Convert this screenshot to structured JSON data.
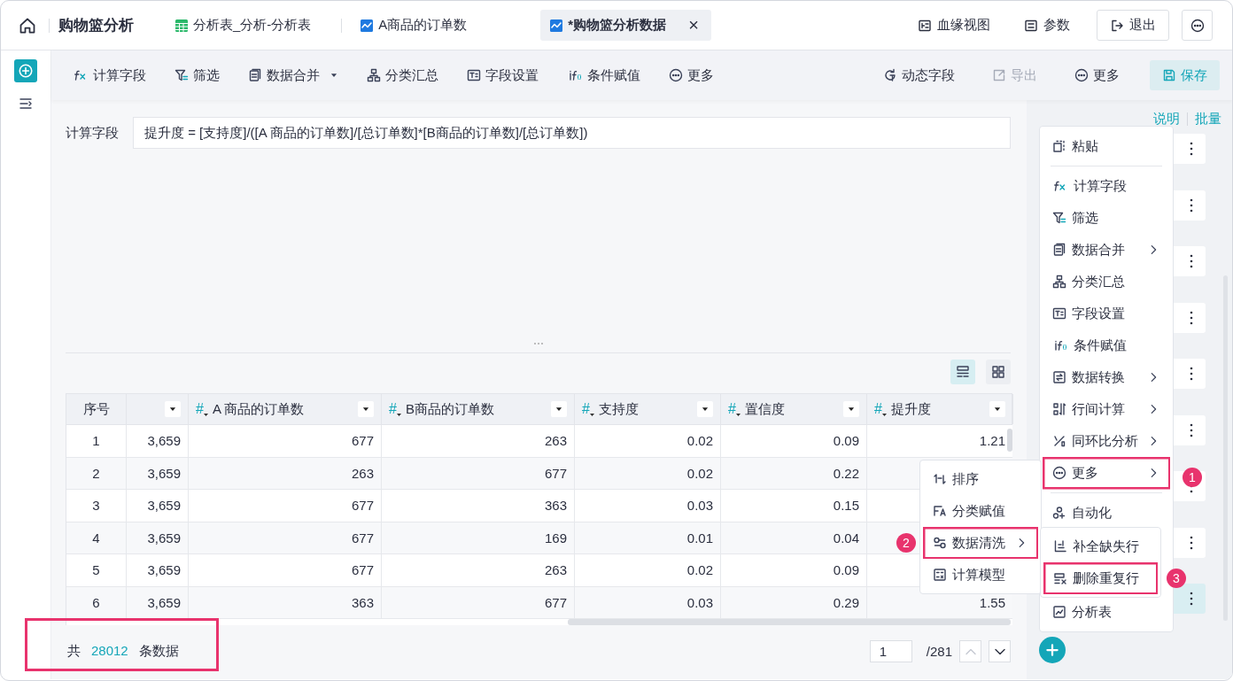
{
  "top_bar": {
    "title": "购物篮分析",
    "tabs": [
      {
        "label": "分析表_分析-分析表",
        "selected": false
      },
      {
        "label": "A商品的订单数",
        "selected": false
      },
      {
        "label": "*购物篮分析数据",
        "selected": true,
        "close": "×"
      }
    ],
    "actions": [
      {
        "kind": "link",
        "label": "血缘视图"
      },
      {
        "kind": "link",
        "label": "参数"
      },
      {
        "kind": "button",
        "label": "退出"
      },
      {
        "kind": "more"
      }
    ]
  },
  "toolbar": {
    "left": [
      {
        "label": "计算字段",
        "dropdown": false
      },
      {
        "label": "筛选",
        "dropdown": false
      },
      {
        "label": "数据合并",
        "dropdown": true
      },
      {
        "label": "分类汇总",
        "dropdown": false
      },
      {
        "label": "字段设置",
        "dropdown": false
      },
      {
        "label": "条件赋值",
        "dropdown": false
      },
      {
        "label": "更多",
        "dropdown": false
      }
    ],
    "right": [
      {
        "label": "动态字段",
        "kind": "plain",
        "disabled": false
      },
      {
        "label": "导出",
        "kind": "plain",
        "disabled": true
      },
      {
        "label": "更多",
        "kind": "plain",
        "disabled": false
      },
      {
        "label": "保存",
        "kind": "primary"
      }
    ]
  },
  "formula": {
    "label": "计算字段",
    "value": "提升度 = [支持度]/([A 商品的订单数]/[总订单数]*[B商品的订单数]/[总订单数])"
  },
  "table": {
    "view_modes": [
      {
        "selected": true
      },
      {
        "selected": false
      }
    ],
    "columns": [
      {
        "kind": "index",
        "label": "序号"
      },
      {
        "kind": "cut"
      },
      {
        "kind": "number",
        "type_symbol": "#",
        "label": "A 商品的订单数"
      },
      {
        "kind": "number",
        "type_symbol": "#",
        "label": "B商品的订单数"
      },
      {
        "kind": "number",
        "type_symbol": "#",
        "label": "支持度"
      },
      {
        "kind": "number",
        "type_symbol": "#",
        "label": "置信度"
      },
      {
        "kind": "number",
        "type_symbol": "#",
        "label": "提升度"
      }
    ],
    "rows": [
      [
        "1",
        "3,659",
        "677",
        "263",
        "0.02",
        "0.09",
        "1.21"
      ],
      [
        "2",
        "3,659",
        "263",
        "677",
        "0.02",
        "0.22",
        null
      ],
      [
        "3",
        "3,659",
        "677",
        "363",
        "0.03",
        "0.15",
        null
      ],
      [
        "4",
        "3,659",
        "677",
        "169",
        "0.01",
        "0.04",
        null
      ],
      [
        "5",
        "3,659",
        "677",
        "263",
        "0.02",
        "0.09",
        null
      ],
      [
        "6",
        "3,659",
        "363",
        "677",
        "0.03",
        "0.29",
        "1.55"
      ]
    ]
  },
  "footer": {
    "prefix": "共",
    "total": "28012",
    "suffix": "条数据",
    "highlighted": true,
    "page": "1",
    "page_count": "/281",
    "prev_disabled": true
  },
  "side_panel": {
    "links": [
      "说明",
      "批量"
    ],
    "steps": [
      {
        "selected": false
      },
      {
        "selected": false
      },
      {
        "selected": false
      },
      {
        "selected": false
      },
      {
        "selected": false
      },
      {
        "selected": false
      },
      {
        "selected": false
      },
      {
        "selected": false
      },
      {
        "selected": true
      }
    ]
  },
  "context_menu": {
    "items": [
      {
        "label": "粘贴",
        "submenu": false,
        "highlighted": false,
        "divider_after": true
      },
      {
        "label": "计算字段",
        "submenu": false,
        "highlighted": false,
        "divider_after": false
      },
      {
        "label": "筛选",
        "submenu": false,
        "highlighted": false,
        "divider_after": false
      },
      {
        "label": "数据合并",
        "submenu": true,
        "highlighted": false,
        "divider_after": false
      },
      {
        "label": "分类汇总",
        "submenu": false,
        "highlighted": false,
        "divider_after": false
      },
      {
        "label": "字段设置",
        "submenu": false,
        "highlighted": false,
        "divider_after": false
      },
      {
        "label": "条件赋值",
        "submenu": false,
        "highlighted": false,
        "divider_after": false
      },
      {
        "label": "数据转换",
        "submenu": true,
        "highlighted": false,
        "divider_after": false
      },
      {
        "label": "行间计算",
        "submenu": true,
        "highlighted": false,
        "divider_after": false
      },
      {
        "label": "同环比分析",
        "submenu": true,
        "highlighted": false,
        "divider_after": false
      },
      {
        "label": "更多",
        "submenu": true,
        "highlighted": true,
        "badge": "1",
        "divider_after": true
      },
      {
        "label": "自动化",
        "submenu": false,
        "highlighted": false,
        "divider_after": false
      },
      {
        "label": "分析表",
        "submenu": false,
        "highlighted": false,
        "divider_after": false
      }
    ]
  },
  "submenu": {
    "items": [
      {
        "label": "排序",
        "submenu": false,
        "highlighted": false
      },
      {
        "label": "分类赋值",
        "submenu": false,
        "highlighted": false
      },
      {
        "label": "数据清洗",
        "submenu": true,
        "highlighted": true,
        "badge": "2"
      },
      {
        "label": "计算模型",
        "submenu": false,
        "highlighted": false
      }
    ]
  },
  "cleaning_menu": {
    "items": [
      {
        "label": "补全缺失行",
        "submenu": false,
        "highlighted": false
      },
      {
        "label": "删除重复行",
        "submenu": false,
        "highlighted": true,
        "badge": "3"
      }
    ]
  }
}
